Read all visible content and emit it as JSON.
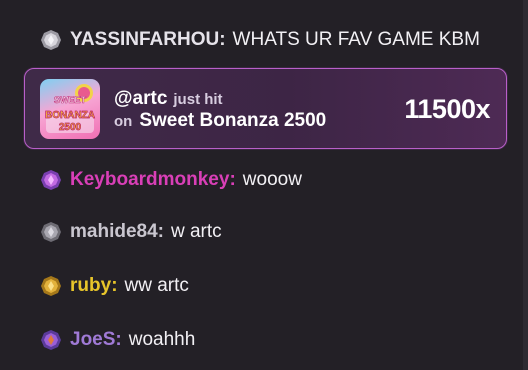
{
  "chat": {
    "messages": [
      {
        "username": "YASSINFARHOU",
        "text": "WHATS UR FAV GAME KBM",
        "badge": "silver-gem-icon",
        "color": "#e6e3ea"
      },
      {
        "username": "Keyboardmonkey",
        "text": "wooow",
        "badge": "purple-gem-icon",
        "color": "#d93fb7"
      },
      {
        "username": "mahide84",
        "text": "w artc",
        "badge": "steel-gem-icon",
        "color": "#c9c6cf"
      },
      {
        "username": "ruby",
        "text": "ww artc",
        "badge": "gold-gem-icon",
        "color": "#e8c52a"
      },
      {
        "username": "JoeS",
        "text": "woahhh",
        "badge": "violet-gem-icon",
        "color": "#a07ad6"
      }
    ],
    "colon": ":"
  },
  "win": {
    "user": "@artc",
    "action": "just hit",
    "on": "on",
    "game": "Sweet Bonanza 2500",
    "multiplier": "11500x",
    "thumb_icon": "sweet-bonanza-thumbnail",
    "thumb_text_top": "SWEET",
    "thumb_text_mid": "BONANZA",
    "thumb_text_bot": "2500",
    "border_color": "#b95fc9"
  }
}
